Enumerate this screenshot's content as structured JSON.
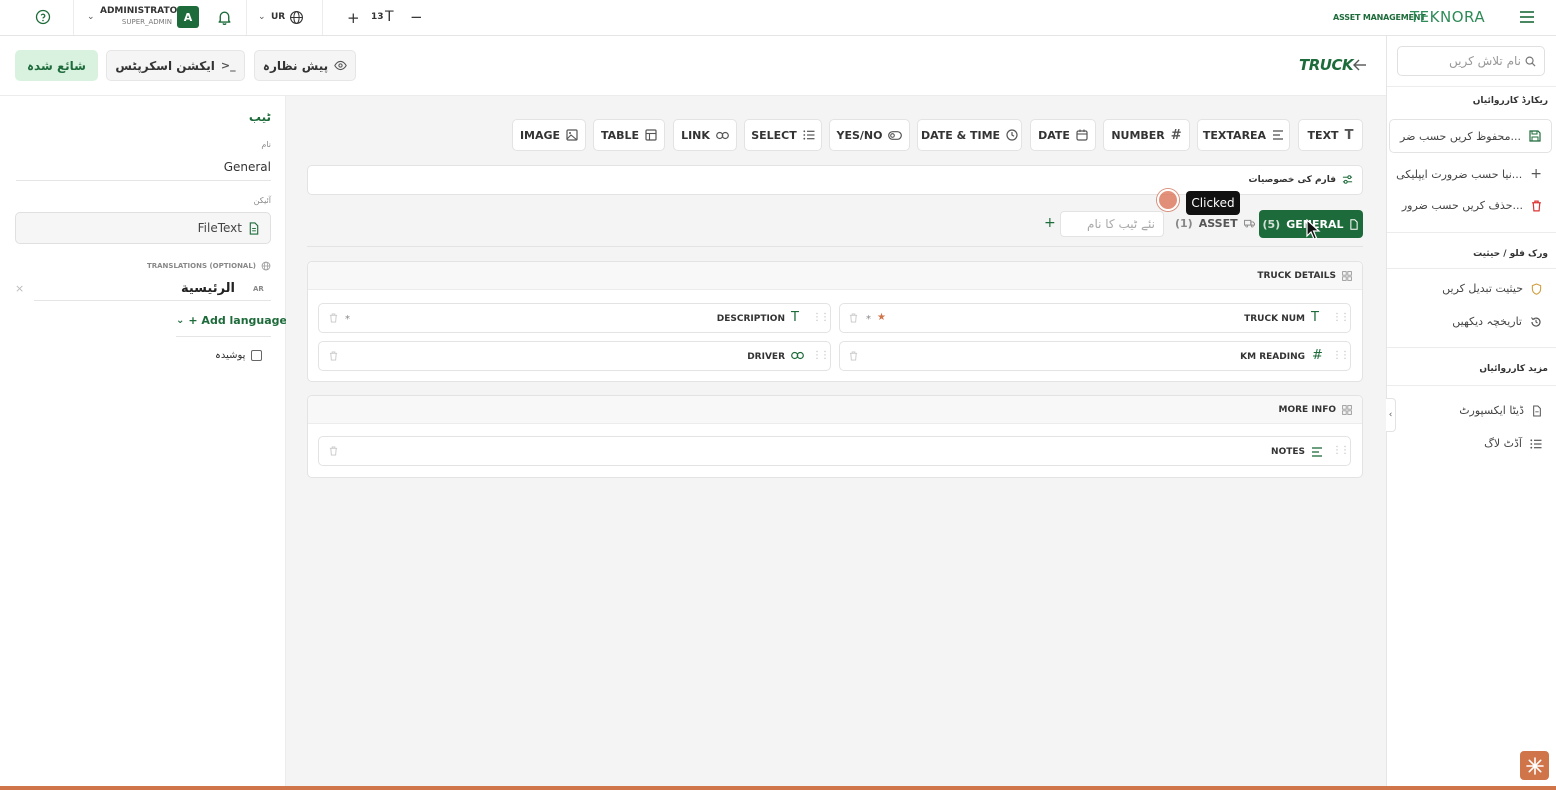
{
  "topbar": {
    "user_name": "ADMINISTRATOR",
    "user_role": "SUPER_ADMIN",
    "avatar_letter": "A",
    "language": "UR",
    "font_size": "13",
    "brand_small": "ASSET MANAGEMENT",
    "brand_logo": "TEKNORA"
  },
  "header": {
    "publish_label": "شائع شدہ",
    "action_script_label": "ایکشن اسکرپٹس",
    "preview_label": "پیش نظارہ",
    "entity_title": "TRUCK"
  },
  "settings": {
    "section_title": "ٹیب",
    "name_label": "نام",
    "name_value": "General",
    "icon_label": "آئیکن",
    "icon_value": "FileText",
    "translations_label": "TRANSLATIONS (OPTIONAL)",
    "lang_code": "AR",
    "translation_value": "الرئيسية",
    "add_language_label": "+ Add language",
    "hidden_label": "پوشیدہ"
  },
  "field_types": [
    "TEXT",
    "TEXTAREA",
    "NUMBER",
    "DATE",
    "DATE & TIME",
    "YES/NO",
    "SELECT",
    "LINK",
    "TABLE",
    "IMAGE"
  ],
  "form_props_label": "فارم کی خصوصیات",
  "tabs": {
    "general_label": "GENERAL",
    "general_count": "(5)",
    "asset_label": "ASSET",
    "asset_count": "(1)",
    "new_tab_placeholder": "نئے ٹیب کا نام",
    "add_symbol": "+"
  },
  "sections": [
    {
      "title": "TRUCK DETAILS",
      "fields": [
        {
          "name": "TRUCK NUM",
          "required": "*"
        },
        {
          "name": "DESCRIPTION",
          "required": "*"
        },
        {
          "name": "KM READING"
        },
        {
          "name": "DRIVER"
        }
      ]
    },
    {
      "title": "MORE INFO",
      "fields": [
        {
          "name": "NOTES"
        }
      ]
    }
  ],
  "sidebar": {
    "search_placeholder": "نام تلاش کریں",
    "record_actions_head": "ریکارڈ کارروائیاں",
    "save_label": "محفوظ کریں حسب ضر...",
    "new_label": "نیا حسب ضرورت ایپلیکی...",
    "delete_label": "حذف کریں حسب ضرور...",
    "workflow_head": "ورک فلو / حیثیت",
    "change_status_label": "حیثیت تبدیل کریں",
    "history_label": "تاریخچہ دیکھیں",
    "more_actions_head": "مزید کارروائیاں",
    "data_export_label": "ڈیٹا ایکسپورٹ",
    "audit_log_label": "آڈٹ لاگ"
  },
  "overlay": {
    "tooltip_label": "Clicked"
  },
  "colors": {
    "brand_green": "#1d6b3a",
    "publish_bg": "#d9f2e0",
    "accent_orange": "#d0744a"
  }
}
